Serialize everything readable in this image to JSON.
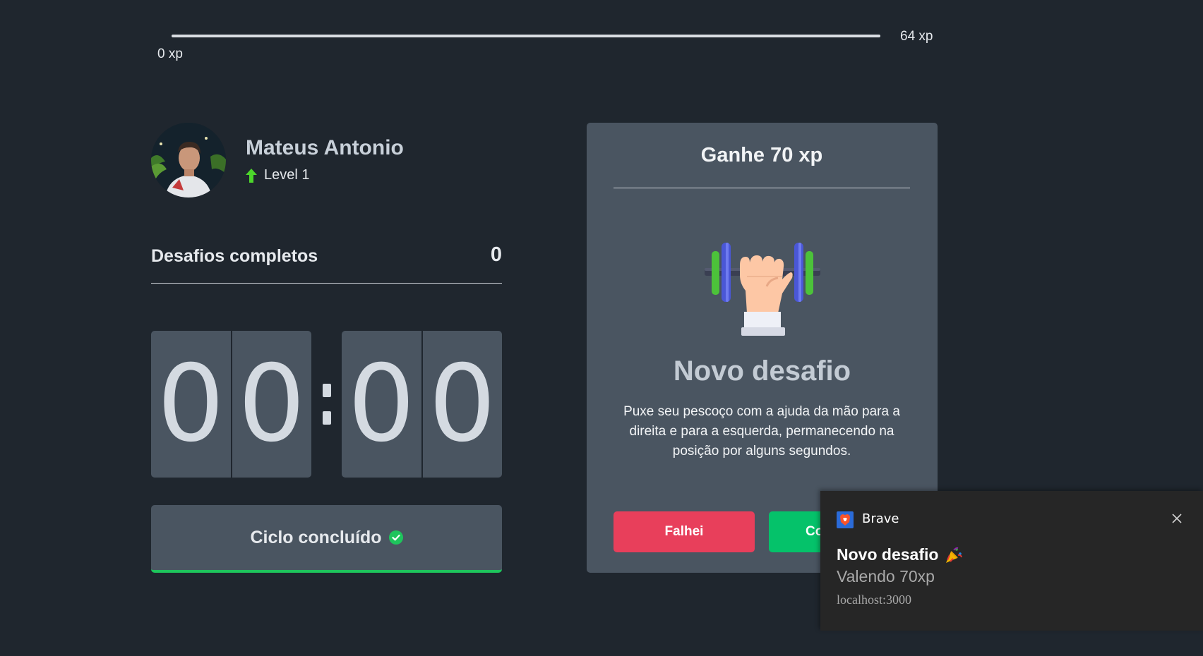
{
  "xp": {
    "current": "0 xp",
    "next_level": "64 xp",
    "progress_fraction": 0
  },
  "profile": {
    "name": "Mateus Antonio",
    "level": "Level 1"
  },
  "completed_challenges": {
    "label": "Desafios completos",
    "value": "0"
  },
  "countdown": {
    "minute_left": "0",
    "minute_right": "0",
    "second_left": "0",
    "second_right": "0"
  },
  "cycle_button": {
    "label": "Ciclo concluído"
  },
  "challenge": {
    "reward": "Ganhe 70 xp",
    "icon": "body-dumbbell-icon",
    "heading": "Novo desafio",
    "description": "Puxe seu pescoço com a ajuda da mão para a direita e para a esquerda, permanecendo na posição por alguns segundos.",
    "fail_label": "Falhei",
    "success_label": "Completei"
  },
  "notification": {
    "app_name": "Brave",
    "title": "Novo desafio",
    "subtitle": "Valendo 70xp",
    "origin": "localhost:3000"
  },
  "colors": {
    "background": "#1f262e",
    "panel": "#4a5561",
    "green": "#4cd62b",
    "red": "#e83f5b",
    "success": "#05c26a"
  }
}
